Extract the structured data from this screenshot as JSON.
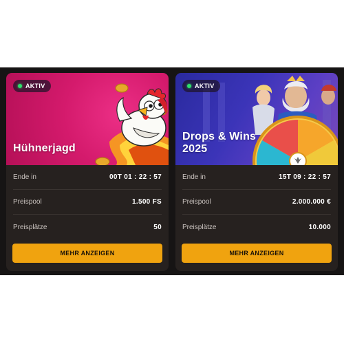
{
  "cards": [
    {
      "badge": "AKTIV",
      "title": "Hühnerjagd",
      "rows": [
        {
          "label": "Ende in",
          "value": "00T  01 : 22 : 57"
        },
        {
          "label": "Preispool",
          "value": "1.500 FS"
        },
        {
          "label": "Preisplätze",
          "value": "50"
        }
      ],
      "button": "MEHR ANZEIGEN"
    },
    {
      "badge": "AKTIV",
      "title": "Drops & Wins 2025",
      "rows": [
        {
          "label": "Ende in",
          "value": "15T  09 : 22 : 57"
        },
        {
          "label": "Preispool",
          "value": "2.000.000 €"
        },
        {
          "label": "Preisplätze",
          "value": "10.000"
        }
      ],
      "button": "MEHR ANZEIGEN"
    }
  ],
  "colors": {
    "accent_button": "#f0a30f",
    "badge_dot": "#2de06b",
    "card_bg": "#26211f",
    "pink_banner": "#d41a6c",
    "blue_banner": "#3b34b8"
  },
  "icons": [
    "chicken-illustration",
    "coin-icon",
    "zeus-illustration",
    "prize-wheel-icon"
  ]
}
